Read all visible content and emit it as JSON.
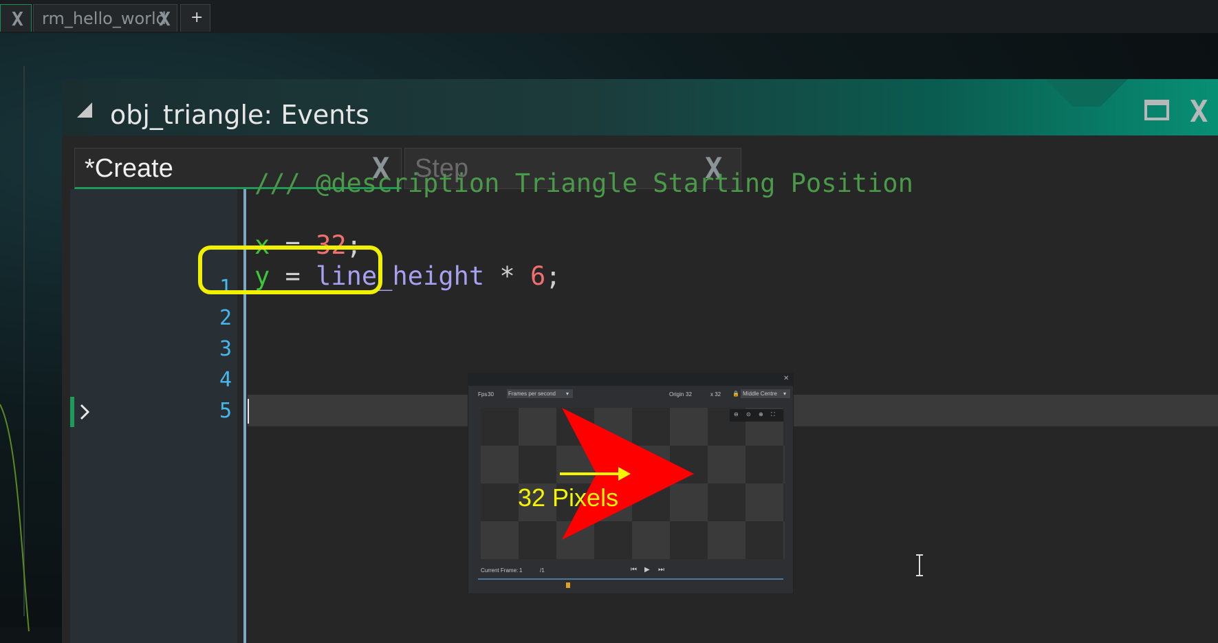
{
  "tabs": {
    "room_tab_label": "rm_hello_world",
    "add_tab": "+"
  },
  "event_window": {
    "title": "obj_triangle: Events",
    "tabs": [
      {
        "label": "*Create",
        "active": true
      },
      {
        "label": "Step",
        "active": false
      }
    ]
  },
  "editor": {
    "line_numbers": [
      "1",
      "2",
      "3",
      "4",
      "5"
    ],
    "lines": {
      "l1": "/// @description Triangle Starting Position",
      "l3_var": "x",
      "l3_op": " = ",
      "l3_num": "32",
      "l3_end": ";",
      "l4_var": "y",
      "l4_op": " = ",
      "l4_builtin": "line_height",
      "l4_op2": " * ",
      "l4_num": "6",
      "l4_end": ";"
    }
  },
  "preview": {
    "fps_label": "Fps",
    "fps_value": "30",
    "fps_mode": "Frames per second",
    "origin_label": "Origin",
    "origin_x": "32",
    "origin_y": "x 32",
    "origin_mode": "Middle Centre",
    "current_frame_label": "Current Frame:",
    "current_frame_value": "1",
    "frame_total": "/1",
    "annotation": "32 Pixels"
  },
  "colors": {
    "accent_teal": "#079276",
    "highlight_yellow": "#f0f000",
    "sprite_red": "#ff0000"
  }
}
